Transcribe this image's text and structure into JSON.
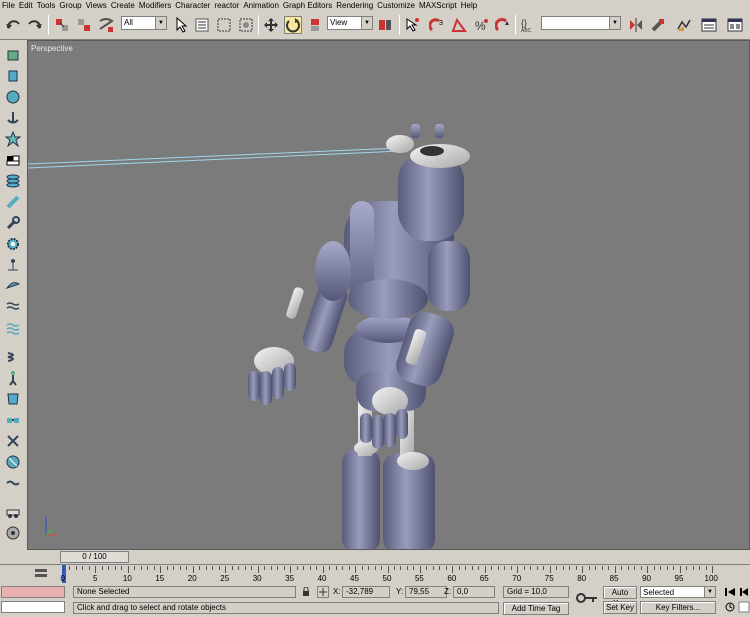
{
  "menu": [
    "File",
    "Edit",
    "Tools",
    "Group",
    "Views",
    "Create",
    "Modifiers",
    "Character",
    "reactor",
    "Animation",
    "Graph Editors",
    "Rendering",
    "Customize",
    "MAXScript",
    "Help"
  ],
  "toolbar": {
    "selection_filter": "All",
    "reference_coord": "View",
    "named_selection": "",
    "icons": [
      "undo-icon",
      "redo-icon",
      "select-and-link-icon",
      "unlink-icon",
      "bind-to-space-warp-icon",
      "select-object-icon",
      "select-by-name-icon",
      "rectangular-selection-icon",
      "window-crossing-icon",
      "select-and-move-icon",
      "select-and-rotate-icon",
      "select-and-scale-icon",
      "use-pivot-center-icon",
      "select-manipulate-icon",
      "snap-3d-icon",
      "angle-snap-icon",
      "percent-snap-icon",
      "spinner-snap-icon",
      "edit-named-selections-icon",
      "mirror-icon",
      "align-icon",
      "layer-manager-icon",
      "curve-editor-icon",
      "schematic-view-icon",
      "material-editor-icon",
      "render-scene-icon"
    ]
  },
  "viewport": {
    "label": "Perspective",
    "background": "#7b7b7b",
    "model_color": "#7c7e9e"
  },
  "timeline": {
    "frame_display": "0 / 100",
    "ticks": [
      "0",
      "5",
      "10",
      "15",
      "20",
      "25",
      "30",
      "35",
      "40",
      "45",
      "50",
      "55",
      "60",
      "65",
      "70",
      "75",
      "80",
      "85",
      "90",
      "95",
      "100"
    ]
  },
  "status": {
    "selection": "None Selected",
    "prompt": "Click and drag to select and rotate objects",
    "x_label": "X:",
    "x_value": "-32,789",
    "y_label": "Y:",
    "y_value": "79,55",
    "z_label": "Z:",
    "z_value": "0,0",
    "grid": "Grid = 10,0",
    "add_time_tag": "Add Time Tag",
    "auto_key": "Auto Key",
    "set_key": "Set Key",
    "key_mode": "Selected",
    "key_filters": "Key Filters..."
  }
}
